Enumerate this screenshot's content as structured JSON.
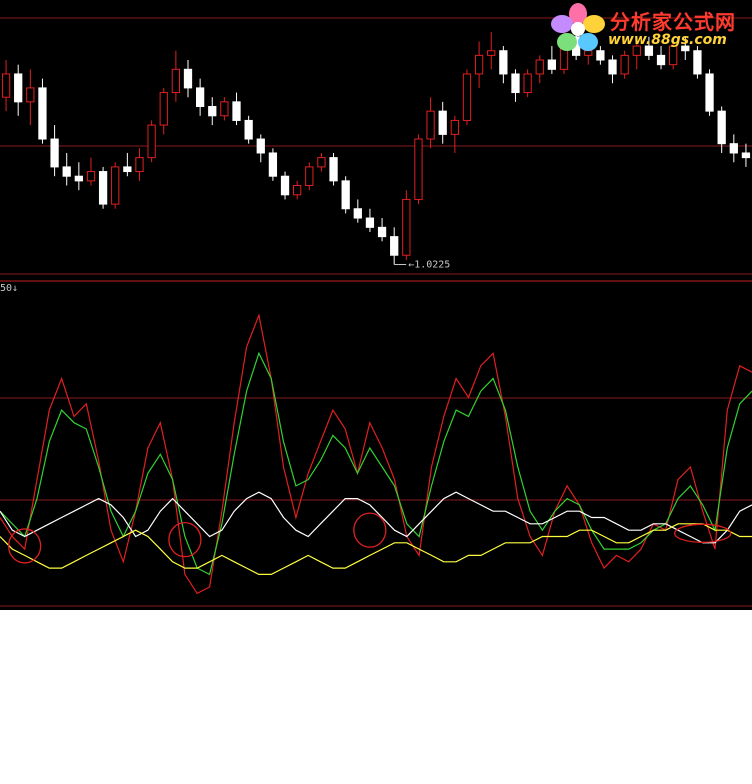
{
  "logo": {
    "title": "分析家公式网",
    "url": "www.88gs.com",
    "colors": {
      "title": "#ff3b2f",
      "url": "#ffd23a"
    }
  },
  "chart_data": [
    {
      "type": "candlestick",
      "panel": "price",
      "low_marker_label": "1.0225",
      "colors": {
        "up": "#e02020",
        "down": "#ffffff",
        "grid": "#8a1a1a",
        "background": "#000000"
      },
      "ohlc": [
        [
          1.058,
          1.066,
          1.055,
          1.063
        ],
        [
          1.063,
          1.065,
          1.054,
          1.057
        ],
        [
          1.057,
          1.064,
          1.052,
          1.06
        ],
        [
          1.06,
          1.062,
          1.048,
          1.049
        ],
        [
          1.049,
          1.052,
          1.041,
          1.043
        ],
        [
          1.043,
          1.046,
          1.039,
          1.041
        ],
        [
          1.041,
          1.044,
          1.038,
          1.04
        ],
        [
          1.04,
          1.045,
          1.039,
          1.042
        ],
        [
          1.042,
          1.043,
          1.034,
          1.035
        ],
        [
          1.035,
          1.044,
          1.034,
          1.043
        ],
        [
          1.043,
          1.046,
          1.041,
          1.042
        ],
        [
          1.042,
          1.047,
          1.04,
          1.045
        ],
        [
          1.045,
          1.053,
          1.044,
          1.052
        ],
        [
          1.052,
          1.06,
          1.05,
          1.059
        ],
        [
          1.059,
          1.068,
          1.057,
          1.064
        ],
        [
          1.064,
          1.066,
          1.058,
          1.06
        ],
        [
          1.06,
          1.062,
          1.054,
          1.056
        ],
        [
          1.056,
          1.058,
          1.052,
          1.054
        ],
        [
          1.054,
          1.058,
          1.053,
          1.057
        ],
        [
          1.057,
          1.059,
          1.052,
          1.053
        ],
        [
          1.053,
          1.054,
          1.048,
          1.049
        ],
        [
          1.049,
          1.05,
          1.044,
          1.046
        ],
        [
          1.046,
          1.047,
          1.04,
          1.041
        ],
        [
          1.041,
          1.042,
          1.036,
          1.037
        ],
        [
          1.037,
          1.04,
          1.036,
          1.039
        ],
        [
          1.039,
          1.044,
          1.038,
          1.043
        ],
        [
          1.043,
          1.046,
          1.042,
          1.045
        ],
        [
          1.045,
          1.046,
          1.039,
          1.04
        ],
        [
          1.04,
          1.041,
          1.033,
          1.034
        ],
        [
          1.034,
          1.036,
          1.031,
          1.032
        ],
        [
          1.032,
          1.034,
          1.029,
          1.03
        ],
        [
          1.03,
          1.032,
          1.027,
          1.028
        ],
        [
          1.028,
          1.03,
          1.022,
          1.024
        ],
        [
          1.024,
          1.038,
          1.023,
          1.036
        ],
        [
          1.036,
          1.05,
          1.035,
          1.049
        ],
        [
          1.049,
          1.058,
          1.047,
          1.055
        ],
        [
          1.055,
          1.057,
          1.048,
          1.05
        ],
        [
          1.05,
          1.054,
          1.046,
          1.053
        ],
        [
          1.053,
          1.064,
          1.052,
          1.063
        ],
        [
          1.063,
          1.07,
          1.06,
          1.067
        ],
        [
          1.067,
          1.072,
          1.064,
          1.068
        ],
        [
          1.068,
          1.069,
          1.061,
          1.063
        ],
        [
          1.063,
          1.064,
          1.057,
          1.059
        ],
        [
          1.059,
          1.064,
          1.058,
          1.063
        ],
        [
          1.063,
          1.067,
          1.061,
          1.066
        ],
        [
          1.066,
          1.069,
          1.063,
          1.064
        ],
        [
          1.064,
          1.072,
          1.063,
          1.071
        ],
        [
          1.071,
          1.073,
          1.066,
          1.067
        ],
        [
          1.067,
          1.07,
          1.065,
          1.068
        ],
        [
          1.068,
          1.069,
          1.065,
          1.066
        ],
        [
          1.066,
          1.067,
          1.061,
          1.063
        ],
        [
          1.063,
          1.068,
          1.062,
          1.067
        ],
        [
          1.067,
          1.07,
          1.064,
          1.069
        ],
        [
          1.069,
          1.071,
          1.066,
          1.067
        ],
        [
          1.067,
          1.069,
          1.064,
          1.065
        ],
        [
          1.065,
          1.07,
          1.064,
          1.069
        ],
        [
          1.069,
          1.071,
          1.066,
          1.068
        ],
        [
          1.068,
          1.069,
          1.062,
          1.063
        ],
        [
          1.063,
          1.064,
          1.054,
          1.055
        ],
        [
          1.055,
          1.056,
          1.046,
          1.048
        ],
        [
          1.048,
          1.05,
          1.044,
          1.046
        ],
        [
          1.046,
          1.048,
          1.043,
          1.045
        ]
      ]
    },
    {
      "type": "line",
      "panel": "oscillator",
      "header_label": "50",
      "ylim": [
        0,
        100
      ],
      "colors": {
        "grid": "#8a1a1a",
        "background": "#000000",
        "circle": "#e02020"
      },
      "series": [
        {
          "color": "#e02020",
          "values": [
            28,
            22,
            18,
            40,
            62,
            72,
            60,
            64,
            46,
            24,
            14,
            30,
            50,
            58,
            40,
            10,
            4,
            6,
            30,
            58,
            82,
            92,
            72,
            44,
            28,
            42,
            52,
            62,
            56,
            42,
            58,
            50,
            40,
            22,
            16,
            44,
            60,
            72,
            66,
            76,
            80,
            60,
            34,
            22,
            16,
            30,
            38,
            32,
            20,
            12,
            16,
            14,
            18,
            26,
            24,
            40,
            44,
            30,
            18,
            62,
            76,
            74
          ]
        },
        {
          "color": "#32d232",
          "values": [
            30,
            26,
            22,
            34,
            52,
            62,
            58,
            56,
            44,
            30,
            22,
            30,
            42,
            48,
            40,
            22,
            12,
            10,
            26,
            48,
            68,
            80,
            72,
            52,
            38,
            40,
            46,
            54,
            50,
            42,
            50,
            44,
            38,
            26,
            22,
            38,
            52,
            62,
            60,
            68,
            72,
            62,
            44,
            30,
            24,
            30,
            34,
            32,
            24,
            18,
            18,
            18,
            20,
            24,
            26,
            34,
            38,
            32,
            24,
            50,
            64,
            68
          ]
        },
        {
          "color": "#ffffff",
          "values": [
            30,
            24,
            22,
            24,
            26,
            28,
            30,
            32,
            34,
            32,
            28,
            22,
            24,
            30,
            34,
            30,
            26,
            22,
            24,
            30,
            34,
            36,
            34,
            28,
            24,
            22,
            26,
            30,
            34,
            34,
            32,
            28,
            24,
            22,
            26,
            30,
            34,
            36,
            34,
            32,
            30,
            30,
            28,
            26,
            26,
            28,
            30,
            30,
            28,
            28,
            26,
            24,
            24,
            26,
            26,
            24,
            22,
            20,
            20,
            24,
            30,
            32
          ]
        },
        {
          "color": "#ffff40",
          "values": [
            22,
            18,
            16,
            14,
            12,
            12,
            14,
            16,
            18,
            20,
            22,
            24,
            22,
            18,
            14,
            12,
            12,
            14,
            16,
            14,
            12,
            10,
            10,
            12,
            14,
            16,
            14,
            12,
            12,
            14,
            16,
            18,
            20,
            20,
            18,
            16,
            14,
            14,
            16,
            16,
            18,
            20,
            20,
            20,
            22,
            22,
            22,
            24,
            24,
            22,
            20,
            20,
            22,
            24,
            24,
            26,
            26,
            26,
            24,
            24,
            22,
            22
          ]
        }
      ],
      "circles_at_index": [
        2,
        15,
        30,
        57
      ]
    }
  ]
}
